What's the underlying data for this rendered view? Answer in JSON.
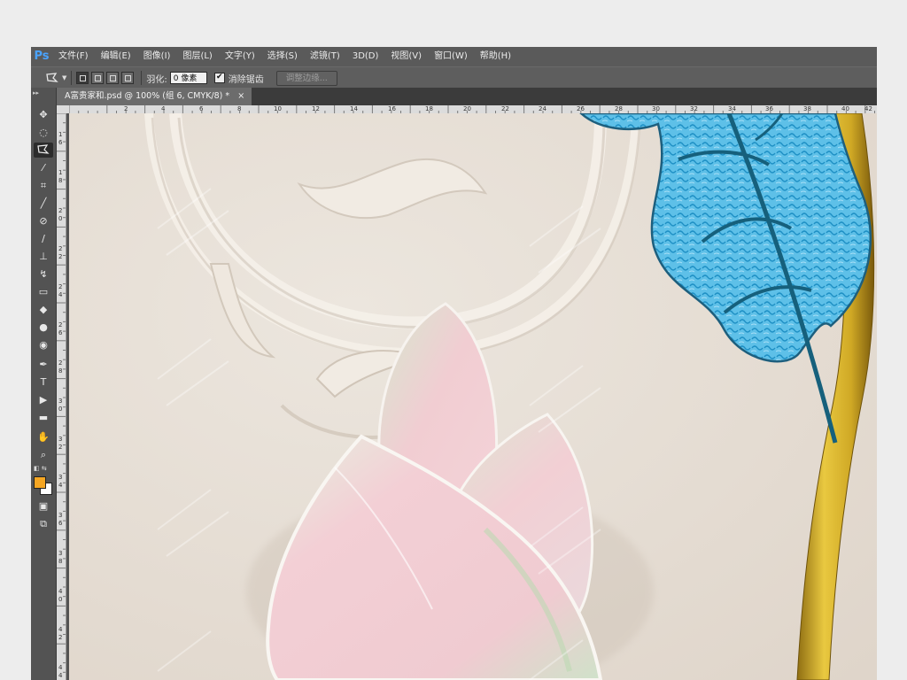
{
  "app": {
    "logo": "Ps"
  },
  "menu": [
    "文件(F)",
    "编辑(E)",
    "图像(I)",
    "图层(L)",
    "文字(Y)",
    "选择(S)",
    "滤镜(T)",
    "3D(D)",
    "视图(V)",
    "窗口(W)",
    "帮助(H)"
  ],
  "options": {
    "feather_label": "羽化:",
    "feather_value": "0 像素",
    "antialias_checked": "✔",
    "antialias_label": "消除锯齿",
    "refine_edge_label": "调整边缘..."
  },
  "document": {
    "tab_title": "A富贵家和.psd @ 100% (组 6, CMYK/8) *",
    "close_icon": "×"
  },
  "rulers": {
    "top": [
      "2",
      "4",
      "6",
      "8",
      "10",
      "12",
      "14",
      "16",
      "18",
      "20",
      "22",
      "24",
      "26",
      "28",
      "30",
      "32",
      "34",
      "36",
      "38",
      "40",
      "42"
    ],
    "left": [
      "1",
      "6",
      "1",
      "8",
      "2",
      "0",
      "2",
      "2",
      "2",
      "4",
      "2",
      "6",
      "2",
      "8",
      "3",
      "0",
      "3",
      "2",
      "3",
      "4",
      "3",
      "6",
      "3",
      "8",
      "4",
      "0",
      "4",
      "2",
      "4",
      "4",
      "4",
      "6"
    ]
  },
  "toolbar": {
    "tools": [
      "move-tool",
      "marquee-tool",
      "polygonal-lasso-tool",
      "magic-wand-tool",
      "crop-tool",
      "eyedropper-tool",
      "healing-brush-tool",
      "brush-tool",
      "clone-stamp-tool",
      "history-brush-tool",
      "eraser-tool",
      "paint-bucket-tool",
      "blur-tool",
      "dodge-tool",
      "pen-tool",
      "type-tool",
      "path-selection-tool",
      "rectangle-tool",
      "hand-tool",
      "zoom-tool",
      "foreground-background-colors",
      "quick-mask-mode",
      "screen-mode"
    ],
    "foreground_color": "#f5a623",
    "background_color": "#ffffff"
  },
  "colors": {
    "canvas_bg": "#e7e0d7",
    "leaf_blue": "#29a6d8",
    "leaf_vein": "#17607a",
    "stem_gold": "#d9b52a",
    "petal_pink": "#f0c9cf",
    "petal_green": "#d7e6cf"
  }
}
